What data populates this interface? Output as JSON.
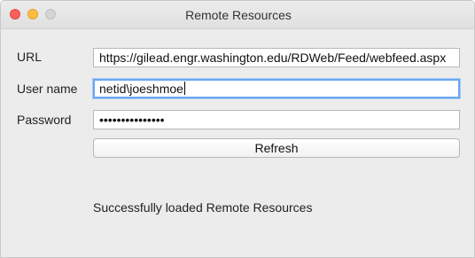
{
  "window": {
    "title": "Remote Resources"
  },
  "form": {
    "url": {
      "label": "URL",
      "value": "https://gilead.engr.washington.edu/RDWeb/Feed/webfeed.aspx"
    },
    "username": {
      "label": "User name",
      "value": "netid\\joeshmoe"
    },
    "password": {
      "label": "Password",
      "value": "•••••••••••••••"
    },
    "refresh_label": "Refresh"
  },
  "status": {
    "message": "Successfully loaded Remote Resources"
  },
  "colors": {
    "focus_ring": "#6aa6ef",
    "close": "#fc605c",
    "minimize": "#fdbc40",
    "zoom_disabled": "#d4d4d4"
  }
}
